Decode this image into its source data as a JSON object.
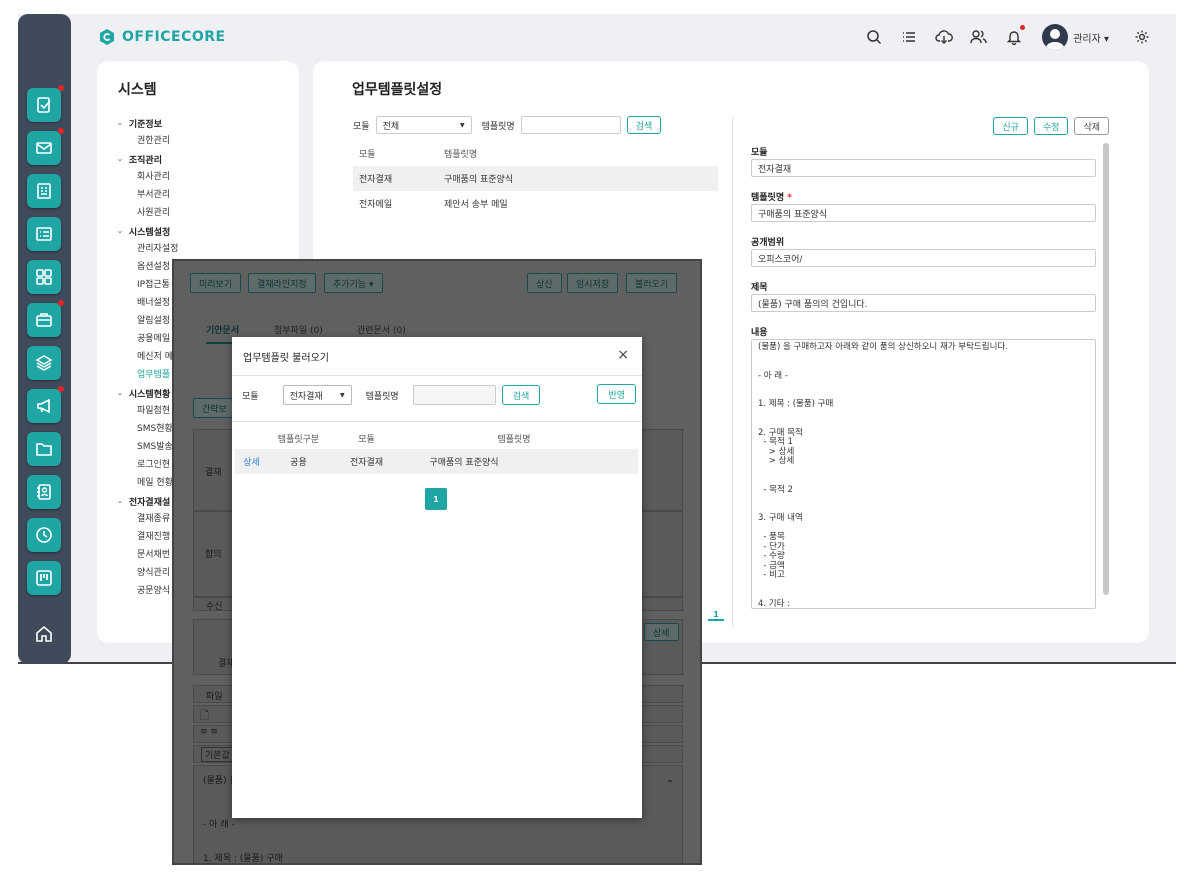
{
  "app": {
    "logo_text": "OFFICECORE",
    "user_name": "관리자 ▾"
  },
  "rail": {
    "icons": [
      "approval-icon",
      "mail-icon",
      "board-icon",
      "list-icon",
      "apps-icon",
      "briefcase-icon",
      "layers-icon",
      "megaphone-icon",
      "folder-icon",
      "contacts-icon",
      "clock-icon",
      "kanban-icon"
    ],
    "home_icon": "home-icon"
  },
  "top_icons": [
    "search-icon",
    "list-icon",
    "cloud-download-icon",
    "users-icon",
    "bell-icon",
    "settings-icon"
  ],
  "sidebar": {
    "title": "시스템",
    "groups": [
      {
        "label": "기준정보",
        "items": [
          "권한관리"
        ]
      },
      {
        "label": "조직관리",
        "items": [
          "회사관리",
          "부서관리",
          "사원관리"
        ]
      },
      {
        "label": "시스템설정",
        "items": [
          "관리자설정",
          "옵션설정",
          "IP접근통",
          "배너설정",
          "알림설정",
          "공용메일",
          "메신저 메",
          "업무템플"
        ]
      },
      {
        "label": "시스템현황",
        "items": [
          "파일첨현",
          "SMS현황",
          "SMS발송",
          "로그인현",
          "메일 현황"
        ]
      },
      {
        "label": "전자결재설",
        "items": [
          "결재종류",
          "결재진행",
          "문서채번",
          "양식관리",
          "공문양식"
        ]
      }
    ]
  },
  "main": {
    "title": "업무템플릿설정",
    "filter": {
      "module_label": "모듈",
      "module_value": "전체",
      "template_label": "템플릿명",
      "search_button": "검색"
    },
    "table": {
      "headers": [
        "모듈",
        "템플릿명"
      ],
      "rows": [
        {
          "module": "전자결재",
          "name": "구매품의 표준양식"
        },
        {
          "module": "전자메일",
          "name": "제안서 송부 메일"
        }
      ]
    },
    "page_number": "1",
    "buttons": {
      "new": "신규",
      "edit": "수정",
      "delete": "삭제"
    },
    "form": {
      "module_label": "모듈",
      "module_value": "전자결재",
      "template_label": "템플릿명",
      "required_mark": "*",
      "template_value": "구매품의 표준양식",
      "scope_label": "공개범위",
      "scope_value": "오피스코어/",
      "subject_label": "제목",
      "subject_value": "(물품) 구매 품의의 건입니다.",
      "content_label": "내용",
      "content_value": "(물품) 을 구매하고자 아래와 같이 품의 상신하오니 재가 부탁드립니다.\n\n\n- 아 래 -\n\n\n1. 제목 : (물품) 구매\n\n\n2. 구매 목적\n  - 목적 1\n    > 상세\n    > 상세\n\n\n  - 목적 2\n\n\n3. 구매 내역\n\n  - 품목\n  - 단가\n  - 수량\n  - 금액\n  - 비고\n\n\n4. 기타 :"
    }
  },
  "docwin": {
    "toolbar_left": [
      "미리보기",
      "결재라인지정",
      "추가기능 ▾"
    ],
    "toolbar_right": [
      "상신",
      "임시저장",
      "불러오기"
    ],
    "tabs": [
      "기안문서",
      "첨부파일 (0)",
      "관련문서 (0)"
    ],
    "brief_button": "간략보",
    "labels": {
      "approval": "결재",
      "agreement": "합의",
      "receive": "수신",
      "detail": "상세",
      "approval2": "결재",
      "file": "파일",
      "default": "기본값"
    },
    "body_lines": [
      "(물품) 을",
      "- 아 래 -",
      "1. 제목 : (물품) 구매"
    ]
  },
  "modal": {
    "title": "업무템플릿 불러오기",
    "close": "×",
    "filter": {
      "module_label": "모듈",
      "module_value": "전자결재",
      "template_label": "템플릿명",
      "search_button": "검색"
    },
    "apply_button": "반영",
    "headers": [
      "",
      "템플릿구분",
      "모듈",
      "템플릿명"
    ],
    "rows": [
      {
        "action": "상세",
        "type": "공용",
        "module": "전자결재",
        "name": "구매품의 표준양식"
      }
    ],
    "page": "1"
  }
}
